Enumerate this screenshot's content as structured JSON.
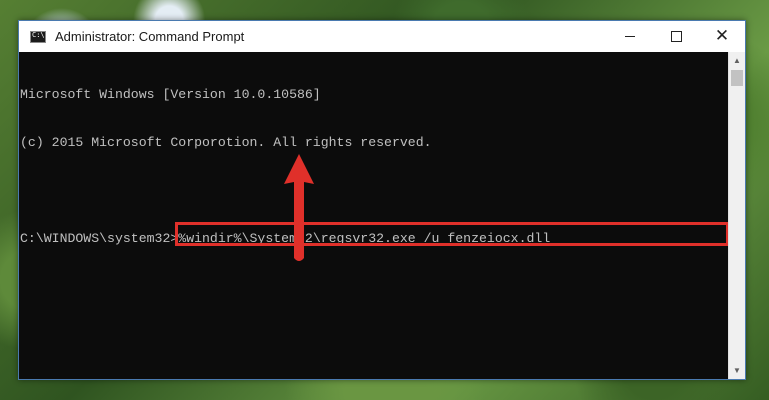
{
  "window": {
    "title": "Administrator: Command Prompt",
    "icon": "cmd-icon",
    "icon_glyph": "C:\\",
    "controls": {
      "minimize": "minimize-icon",
      "maximize": "maximize-icon",
      "close": "close-icon",
      "close_glyph": "✕"
    }
  },
  "console": {
    "line1": "Microsoft Windows [Version 10.0.10586]",
    "line2": "(c) 2015 Microsoft Corporotion. All rights reserved.",
    "prompt": "C:\\WINDOWS\\system32>",
    "command": "%windir%\\System32\\regsvr32.exe /u fenzeiocx.dll"
  },
  "colors": {
    "highlight": "#e0302a",
    "arrow": "#e0302a",
    "console_bg": "#0c0c0c",
    "console_text": "#c0c0c0"
  }
}
